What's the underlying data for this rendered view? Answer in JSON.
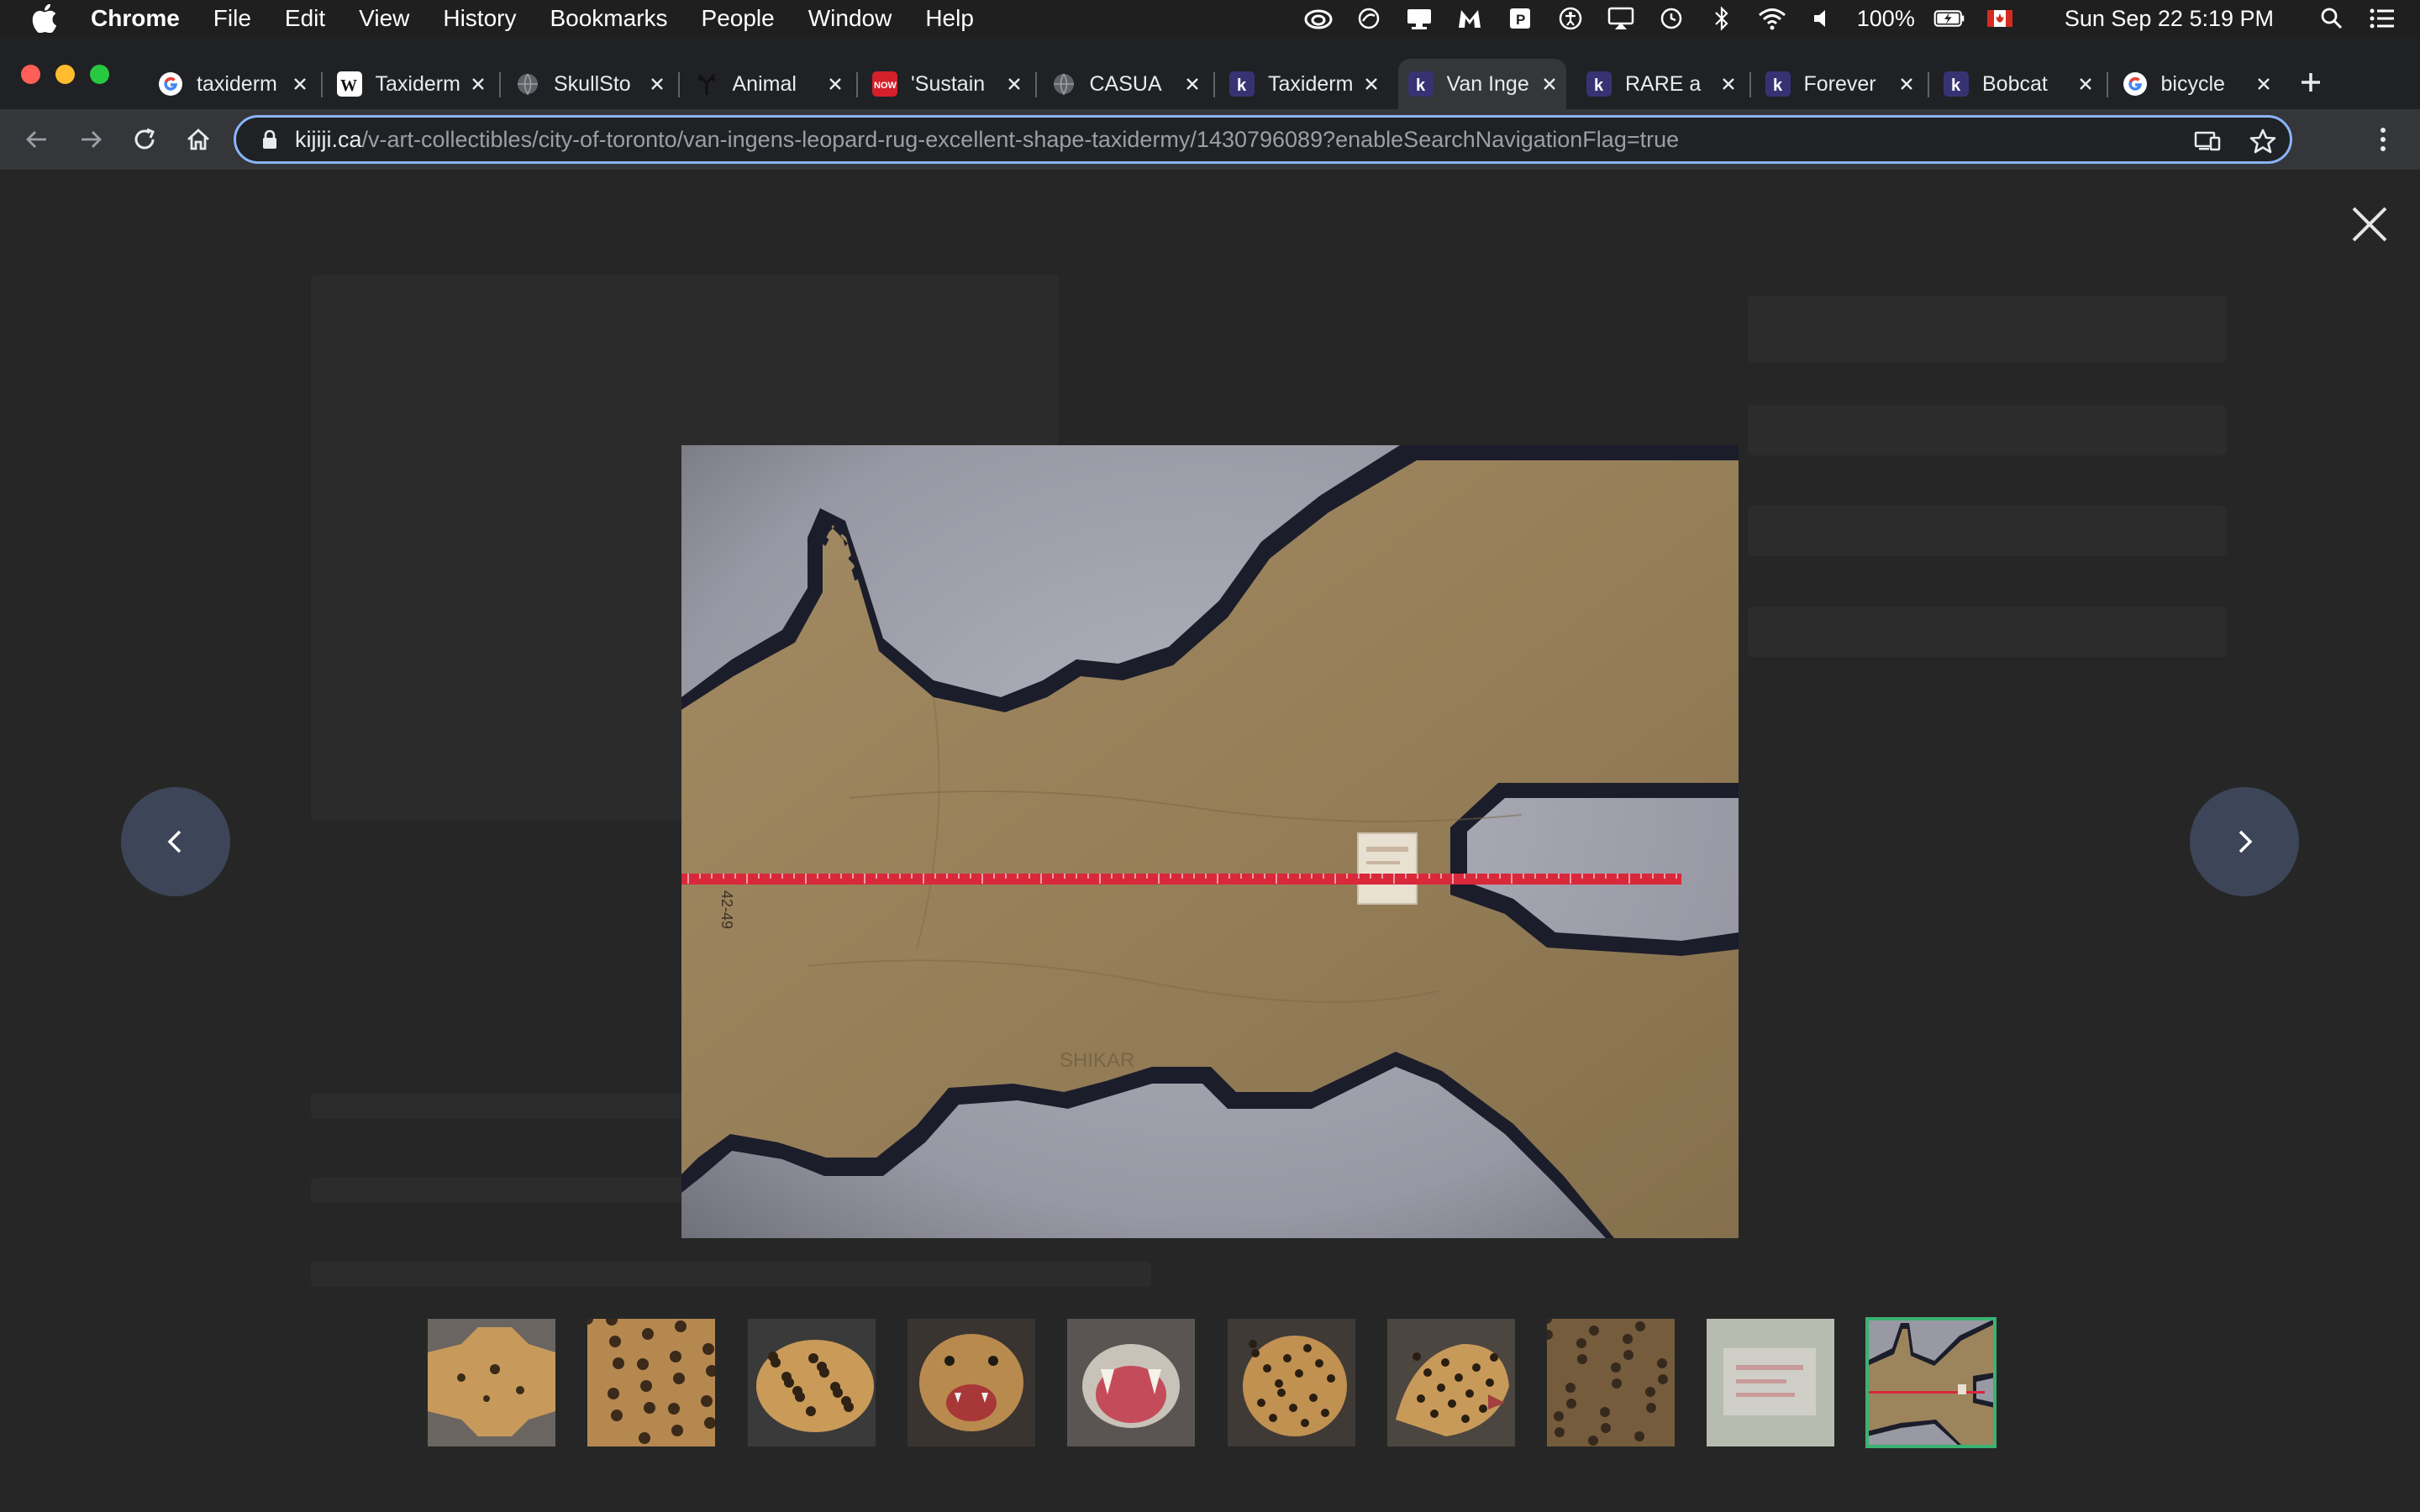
{
  "menubar": {
    "app_name": "Chrome",
    "menus": [
      "File",
      "Edit",
      "View",
      "History",
      "Bookmarks",
      "People",
      "Window",
      "Help"
    ],
    "battery_text": "100%",
    "datetime": "Sun Sep 22  5:19 PM"
  },
  "tabs": [
    {
      "title": "taxiderm",
      "favicon": "google-icon"
    },
    {
      "title": "Taxiderm",
      "favicon": "wikipedia-icon"
    },
    {
      "title": "SkullSto",
      "favicon": "globe-icon"
    },
    {
      "title": "Animal",
      "favicon": "antler-icon"
    },
    {
      "title": "'Sustain",
      "favicon": "now-icon"
    },
    {
      "title": "CASUA",
      "favicon": "globe-icon"
    },
    {
      "title": "Taxiderm",
      "favicon": "kijiji-icon"
    },
    {
      "title": "Van Inge",
      "favicon": "kijiji-icon",
      "active": true
    },
    {
      "title": "RARE a",
      "favicon": "kijiji-icon"
    },
    {
      "title": "Forever",
      "favicon": "kijiji-icon"
    },
    {
      "title": "Bobcat",
      "favicon": "kijiji-icon"
    },
    {
      "title": "bicycle",
      "favicon": "google-icon"
    }
  ],
  "address_bar": {
    "host": "kijiji.ca",
    "path": "/v-art-collectibles/city-of-toronto/van-ingens-leopard-rug-excellent-shape-taxidermy/1430796089?enableSearchNavigationFlag=true"
  },
  "gallery": {
    "main_image": "leopard-rug-underside-with-measuring-tape",
    "photo_markings": {
      "side_number": "42-49",
      "stamp": "SHIKAR"
    },
    "thumbnails": [
      {
        "name": "rug-full-top"
      },
      {
        "name": "fur-spots-closeup"
      },
      {
        "name": "rug-head-side"
      },
      {
        "name": "leopard-face-open-mouth"
      },
      {
        "name": "leopard-mouth-teeth"
      },
      {
        "name": "leopard-head-front"
      },
      {
        "name": "leopard-head-profile"
      },
      {
        "name": "fur-texture"
      },
      {
        "name": "label-card"
      },
      {
        "name": "rug-underside-measuring",
        "selected": true
      }
    ]
  },
  "colors": {
    "overlay_bg": "#262626",
    "arrow_button": "#3d4558",
    "selected_thumb_border": "#3bb273",
    "omnibox_focus": "#8ab4f8",
    "measuring_tape": "#d8283a"
  }
}
